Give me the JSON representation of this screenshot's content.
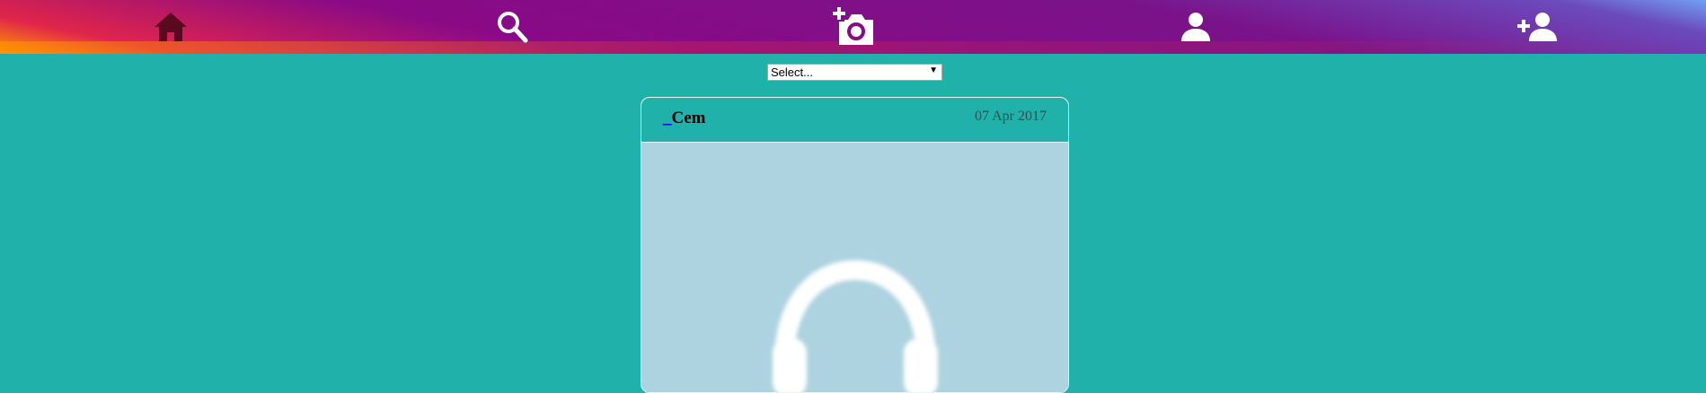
{
  "nav": {
    "items": [
      {
        "icon": "home-icon",
        "color": "#5a0a1e"
      },
      {
        "icon": "search-icon",
        "color": "#ffffff"
      },
      {
        "icon": "add-photo-icon",
        "color": "#ffffff"
      },
      {
        "icon": "profile-icon",
        "color": "#ffffff"
      },
      {
        "icon": "add-user-icon",
        "color": "#ffffff"
      }
    ]
  },
  "filter": {
    "selected": "Select...",
    "arrow": "▼"
  },
  "post": {
    "author_prefix": "_",
    "author": "Cem",
    "date": "07 Apr 2017",
    "image_icon": "headphones-icon"
  },
  "colors": {
    "background": "#20b2aa",
    "image_bg": "#add3e0"
  }
}
